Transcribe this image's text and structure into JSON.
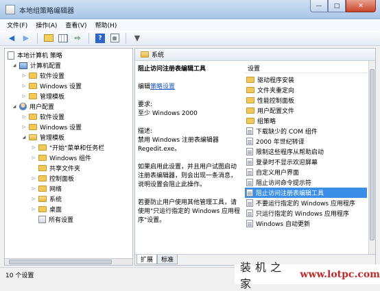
{
  "window": {
    "title": "本地组策略编辑器",
    "buttons": {
      "minimize": "—",
      "maximize": "□",
      "close": "✕"
    }
  },
  "menu": [
    "文件(F)",
    "操作(A)",
    "查看(V)",
    "帮助(H)"
  ],
  "toolbar_icons": [
    "back-icon",
    "forward-icon",
    "up-folder-icon",
    "show-tree-icon",
    "export-icon",
    "help-icon",
    "properties-icon",
    "filter-icon"
  ],
  "tree": [
    {
      "label": "本地计算机 策略",
      "icon": "computer-policy-icon",
      "depth": 0
    },
    {
      "label": "计算机配置",
      "icon": "computer-icon",
      "depth": 1,
      "expander": "collapse"
    },
    {
      "label": "软件设置",
      "icon": "folder-icon",
      "depth": 2,
      "expander": "expand"
    },
    {
      "label": "Windows 设置",
      "icon": "folder-icon",
      "depth": 2,
      "expander": "expand"
    },
    {
      "label": "管理模板",
      "icon": "folder-icon",
      "depth": 2,
      "expander": "expand"
    },
    {
      "label": "用户配置",
      "icon": "user-icon",
      "depth": 1,
      "expander": "collapse"
    },
    {
      "label": "软件设置",
      "icon": "folder-icon",
      "depth": 2,
      "expander": "expand"
    },
    {
      "label": "Windows 设置",
      "icon": "folder-icon",
      "depth": 2,
      "expander": "expand"
    },
    {
      "label": "管理模板",
      "icon": "folder-icon",
      "depth": 2,
      "expander": "collapse"
    },
    {
      "label": "\"开始\"菜单和任务栏",
      "icon": "folder-icon",
      "depth": 3,
      "expander": "expand"
    },
    {
      "label": "Windows 组件",
      "icon": "folder-icon",
      "depth": 3,
      "expander": "expand"
    },
    {
      "label": "共享文件夹",
      "icon": "folder-icon",
      "depth": 3,
      "expander": ""
    },
    {
      "label": "控制面板",
      "icon": "folder-icon",
      "depth": 3,
      "expander": "expand"
    },
    {
      "label": "网络",
      "icon": "folder-icon",
      "depth": 3,
      "expander": "expand"
    },
    {
      "label": "系统",
      "icon": "folder-icon",
      "depth": 3,
      "expander": "expand"
    },
    {
      "label": "桌面",
      "icon": "folder-icon",
      "depth": 3,
      "expander": "expand"
    },
    {
      "label": "所有设置",
      "icon": "all-settings-icon",
      "depth": 3,
      "expander": ""
    }
  ],
  "content": {
    "header": "系统",
    "desc": {
      "title": "阻止访问注册表编辑工具",
      "edit_prefix": "编辑",
      "edit_link": "策略设置",
      "req_label": "要求:",
      "req_value": "至少 Windows 2000",
      "desc_label": "描述:",
      "desc_text": "禁用 Windows 注册表编辑器 Regedit.exe。",
      "para1": "如果启用此设置，并且用户试图启动注册表编辑器，则会出现一条消息，说明设置会阻止此操作。",
      "para2": "若要防止用户使用其他管理工具，请使用\"只运行指定的 Windows 应用程序\"设置。"
    },
    "column_header": "设置",
    "items": [
      {
        "label": "驱动程序安装",
        "type": "folder"
      },
      {
        "label": "文件夹重定向",
        "type": "folder"
      },
      {
        "label": "性能控制面板",
        "type": "folder"
      },
      {
        "label": "用户配置文件",
        "type": "folder"
      },
      {
        "label": "组策略",
        "type": "folder"
      },
      {
        "label": "下载缺少的 COM 组件",
        "type": "policy"
      },
      {
        "label": "2000 年世纪转译",
        "type": "policy"
      },
      {
        "label": "限制这些程序从帮助启动",
        "type": "policy"
      },
      {
        "label": "登录时不显示欢迎屏幕",
        "type": "policy"
      },
      {
        "label": "自定义用户界面",
        "type": "policy"
      },
      {
        "label": "阻止访问命令提示符",
        "type": "policy"
      },
      {
        "label": "阻止访问注册表编辑工具",
        "type": "policy",
        "selected": true
      },
      {
        "label": "不要运行指定的 Windows 应用程序",
        "type": "policy"
      },
      {
        "label": "只运行指定的 Windows 应用程序",
        "type": "policy"
      },
      {
        "label": "Windows 自动更新",
        "type": "policy"
      }
    ],
    "tabs": [
      "扩展",
      "标准"
    ]
  },
  "status": "10 个设置",
  "watermark": {
    "brand": "装机之家",
    "url": "www.lotpc.com"
  },
  "colors": {
    "selection": "#3a8ee8",
    "link": "#1a56c2",
    "watermark_url": "#c02a2a"
  }
}
